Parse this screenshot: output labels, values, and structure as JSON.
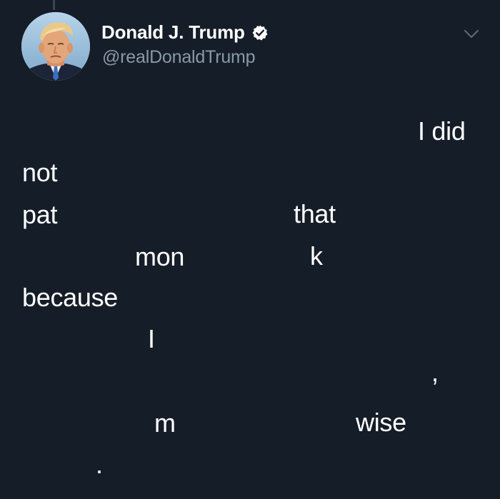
{
  "tweet": {
    "author": {
      "display_name": "Donald J. Trump",
      "handle": "@realDonaldTrump",
      "verified": true,
      "avatar_icon": "profile-photo-avatar",
      "verified_icon": "verified-check-icon"
    },
    "menu_icon": "chevron-down-icon",
    "body_words": {
      "w1": "I did",
      "w2": "not",
      "w3": "pat",
      "w4": "that",
      "w5": "mon",
      "w6": "k",
      "w7": "because",
      "w8": "I",
      "w9": ",",
      "w10": "m",
      "w11": "wise",
      "w12": "."
    }
  },
  "colors": {
    "background": "#151d28",
    "primary_text": "#ffffff",
    "secondary_text": "#8899a6",
    "verified_badge": "#ffffff"
  }
}
